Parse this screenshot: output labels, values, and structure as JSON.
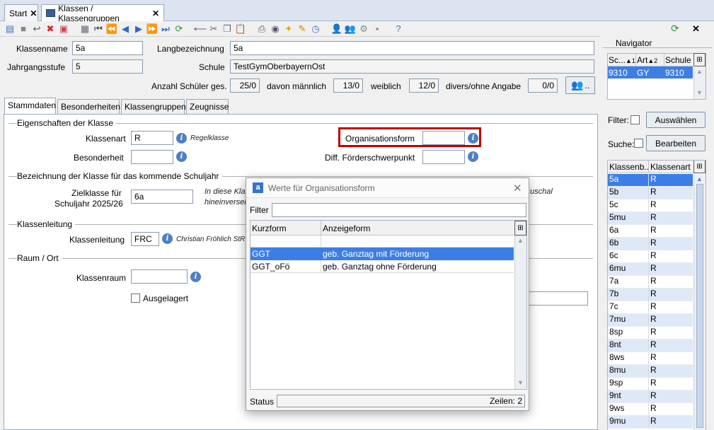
{
  "tabs": {
    "start": "Start",
    "klassen": "Klassen / Klassengruppen"
  },
  "header": {
    "klassenname_label": "Klassenname",
    "klassenname_value": "5a",
    "langbezeichnung_label": "Langbezeichnung",
    "langbezeichnung_value": "5a",
    "jahrgangsstufe_label": "Jahrgangsstufe",
    "jahrgangsstufe_value": "5",
    "schule_label": "Schule",
    "schule_value": "TestGymOberbayernOst",
    "anzahl_label": "Anzahl Schüler ges.",
    "anzahl_value": "25/0",
    "maennlich_label": "davon männlich",
    "maennlich_value": "13/0",
    "weiblich_label": "weiblich",
    "weiblich_value": "12/0",
    "divers_label": "divers/ohne Angabe",
    "divers_value": "0/0",
    "dots_button": ".."
  },
  "subtabs": [
    "Stammdaten",
    "Besonderheiten",
    "Klassengruppen",
    "Zeugnisse"
  ],
  "stammdaten": {
    "section_eigenschaften": "Eigenschaften der Klasse",
    "klassenart_label": "Klassenart",
    "klassenart_value": "R",
    "klassenart_hint": "Regelklasse",
    "besonderheit_label": "Besonderheit",
    "besonderheit_value": "",
    "orgform_label": "Organisationsform",
    "orgform_value": "",
    "foerder_label": "Diff. Förderschwerpunkt",
    "foerder_value": "",
    "section_bezeichnung": "Bezeichnung der Klasse für das kommende Schuljahr",
    "zielklasse_label_1": "Zielklasse für",
    "zielklasse_label_2": "Schuljahr 2025/26",
    "zielklasse_value": "6a",
    "zielklasse_hint_1": "In diese Klas",
    "zielklasse_hint_2": "hineinversel",
    "zielklasse_hint_3": "uschal",
    "section_klassenleitung": "Klassenleitung",
    "klassenleitung_label": "Klassenleitung",
    "klassenleitung_value": "FRC",
    "klassenleitung_hint": "Christian Fröhlich StR",
    "section_raum": "Raum / Ort",
    "klassenraum_label": "Klassenraum",
    "klassenraum_value": "",
    "ausgelagert_label": "Ausgelagert"
  },
  "dialog": {
    "title": "Werte für Organisationsform",
    "filter_label": "Filter",
    "filter_value": "",
    "col_kurzform": "Kurzform",
    "col_anzeigeform": "Anzeigeform",
    "rows": [
      {
        "kurz": "GGT",
        "anzeige": "geb. Ganztag mit Förderung"
      },
      {
        "kurz": "GGT_oFö",
        "anzeige": "geb. Ganztag ohne Förderung"
      }
    ],
    "status_label": "Status",
    "zeilen": "Zeilen: 2"
  },
  "navigator": {
    "title": "Navigator",
    "col_sc": "Sc...",
    "col_sc_sort": "▲1",
    "col_art": "Art",
    "col_art_sort": "▲2",
    "col_schule": "Schule",
    "top_row": {
      "sc": "9310",
      "art": "GY",
      "schule": "9310"
    },
    "filter_label": "Filter:",
    "auswaehlen": "Auswählen",
    "suche_label": "Suche:",
    "bearbeiten": "Bearbeiten",
    "col_klassenb": "Klassenb...",
    "col_klassenart": "Klassenart",
    "klassen": [
      {
        "name": "5a",
        "art": "R"
      },
      {
        "name": "5b",
        "art": "R"
      },
      {
        "name": "5c",
        "art": "R"
      },
      {
        "name": "5mu",
        "art": "R"
      },
      {
        "name": "6a",
        "art": "R"
      },
      {
        "name": "6b",
        "art": "R"
      },
      {
        "name": "6c",
        "art": "R"
      },
      {
        "name": "6mu",
        "art": "R"
      },
      {
        "name": "7a",
        "art": "R"
      },
      {
        "name": "7b",
        "art": "R"
      },
      {
        "name": "7c",
        "art": "R"
      },
      {
        "name": "7mu",
        "art": "R"
      },
      {
        "name": "8sp",
        "art": "R"
      },
      {
        "name": "8nt",
        "art": "R"
      },
      {
        "name": "8ws",
        "art": "R"
      },
      {
        "name": "8mu",
        "art": "R"
      },
      {
        "name": "9sp",
        "art": "R"
      },
      {
        "name": "9nt",
        "art": "R"
      },
      {
        "name": "9ws",
        "art": "R"
      },
      {
        "name": "9mu",
        "art": "R"
      }
    ]
  },
  "colors": {
    "accent": "#3d7ee6",
    "highlight_box": "#c00000"
  }
}
